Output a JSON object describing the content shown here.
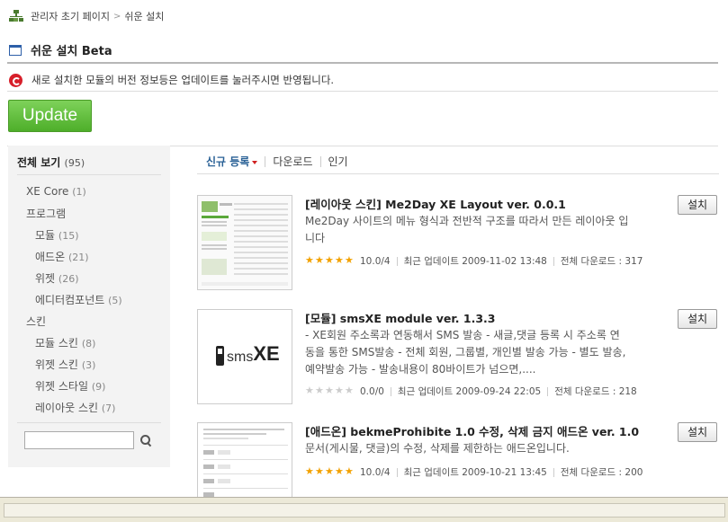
{
  "breadcrumb": {
    "home": "관리자 초기 페이지",
    "separator": ">",
    "current": "쉬운 설치"
  },
  "page": {
    "title": "쉬운 설치 Beta"
  },
  "notice": {
    "text": "새로 설치한 모듈의 버전 정보등은 업데이트를 눌러주시면 반영됩니다."
  },
  "update_button": "Update",
  "sidebar": {
    "all_label": "전체 보기",
    "all_count": "(95)",
    "categories": [
      {
        "label": "XE Core",
        "count": "(1)"
      },
      {
        "label": "프로그램",
        "count": ""
      },
      {
        "label": "모듈",
        "count": "(15)"
      },
      {
        "label": "애드온",
        "count": "(21)"
      },
      {
        "label": "위젯",
        "count": "(26)"
      },
      {
        "label": "에디터컴포넌트",
        "count": "(5)"
      },
      {
        "label": "스킨",
        "count": ""
      },
      {
        "label": "모듈 스킨",
        "count": "(8)"
      },
      {
        "label": "위젯 스킨",
        "count": "(3)"
      },
      {
        "label": "위젯 스타일",
        "count": "(9)"
      },
      {
        "label": "레이아웃 스킨",
        "count": "(7)"
      }
    ],
    "search_placeholder": ""
  },
  "tabs": [
    {
      "label": "신규 등록",
      "active": true
    },
    {
      "label": "다운로드",
      "active": false
    },
    {
      "label": "인기",
      "active": false
    }
  ],
  "items": [
    {
      "title": "[레이아웃 스킨] Me2Day XE Layout ver. 0.0.1",
      "description": "Me2Day 사이트의 메뉴 형식과 전반적 구조를 따라서 만든 레이아웃 입니다",
      "rating_stars": 5,
      "rating": "10.0/4",
      "updated": "최근 업데이트 2009-11-02 13:48",
      "downloads": "전체 다운로드 : 317",
      "install_label": "설치"
    },
    {
      "title": "[모듈] smsXE module ver. 1.3.3",
      "description": "- XE회원 주소록과 연동해서 SMS 발송 - 새글,댓글 등록 시 주소록 연동을 통한 SMS발송 - 전체 회원, 그룹별, 개인별 발송 가능 - 별도 발송, 예약발송 가능 - 발송내용이 80바이트가 넘으면,....",
      "rating_stars": 0,
      "rating": "0.0/0",
      "updated": "최근 업데이트 2009-09-24 22:05",
      "downloads": "전체 다운로드 : 218",
      "install_label": "설치",
      "thumb_sms": "sms",
      "thumb_xe": "XE"
    },
    {
      "title": "[애드온] bekmeProhibite 1.0 수정, 삭제 금지 애드온 ver. 1.0",
      "description": "문서(게시물, 댓글)의 수정, 삭제를 제한하는 애드온입니다.",
      "rating_stars": 5,
      "rating": "10.0/4",
      "updated": "최근 업데이트 2009-10-21 13:45",
      "downloads": "전체 다운로드 : 200",
      "install_label": "설치"
    }
  ]
}
